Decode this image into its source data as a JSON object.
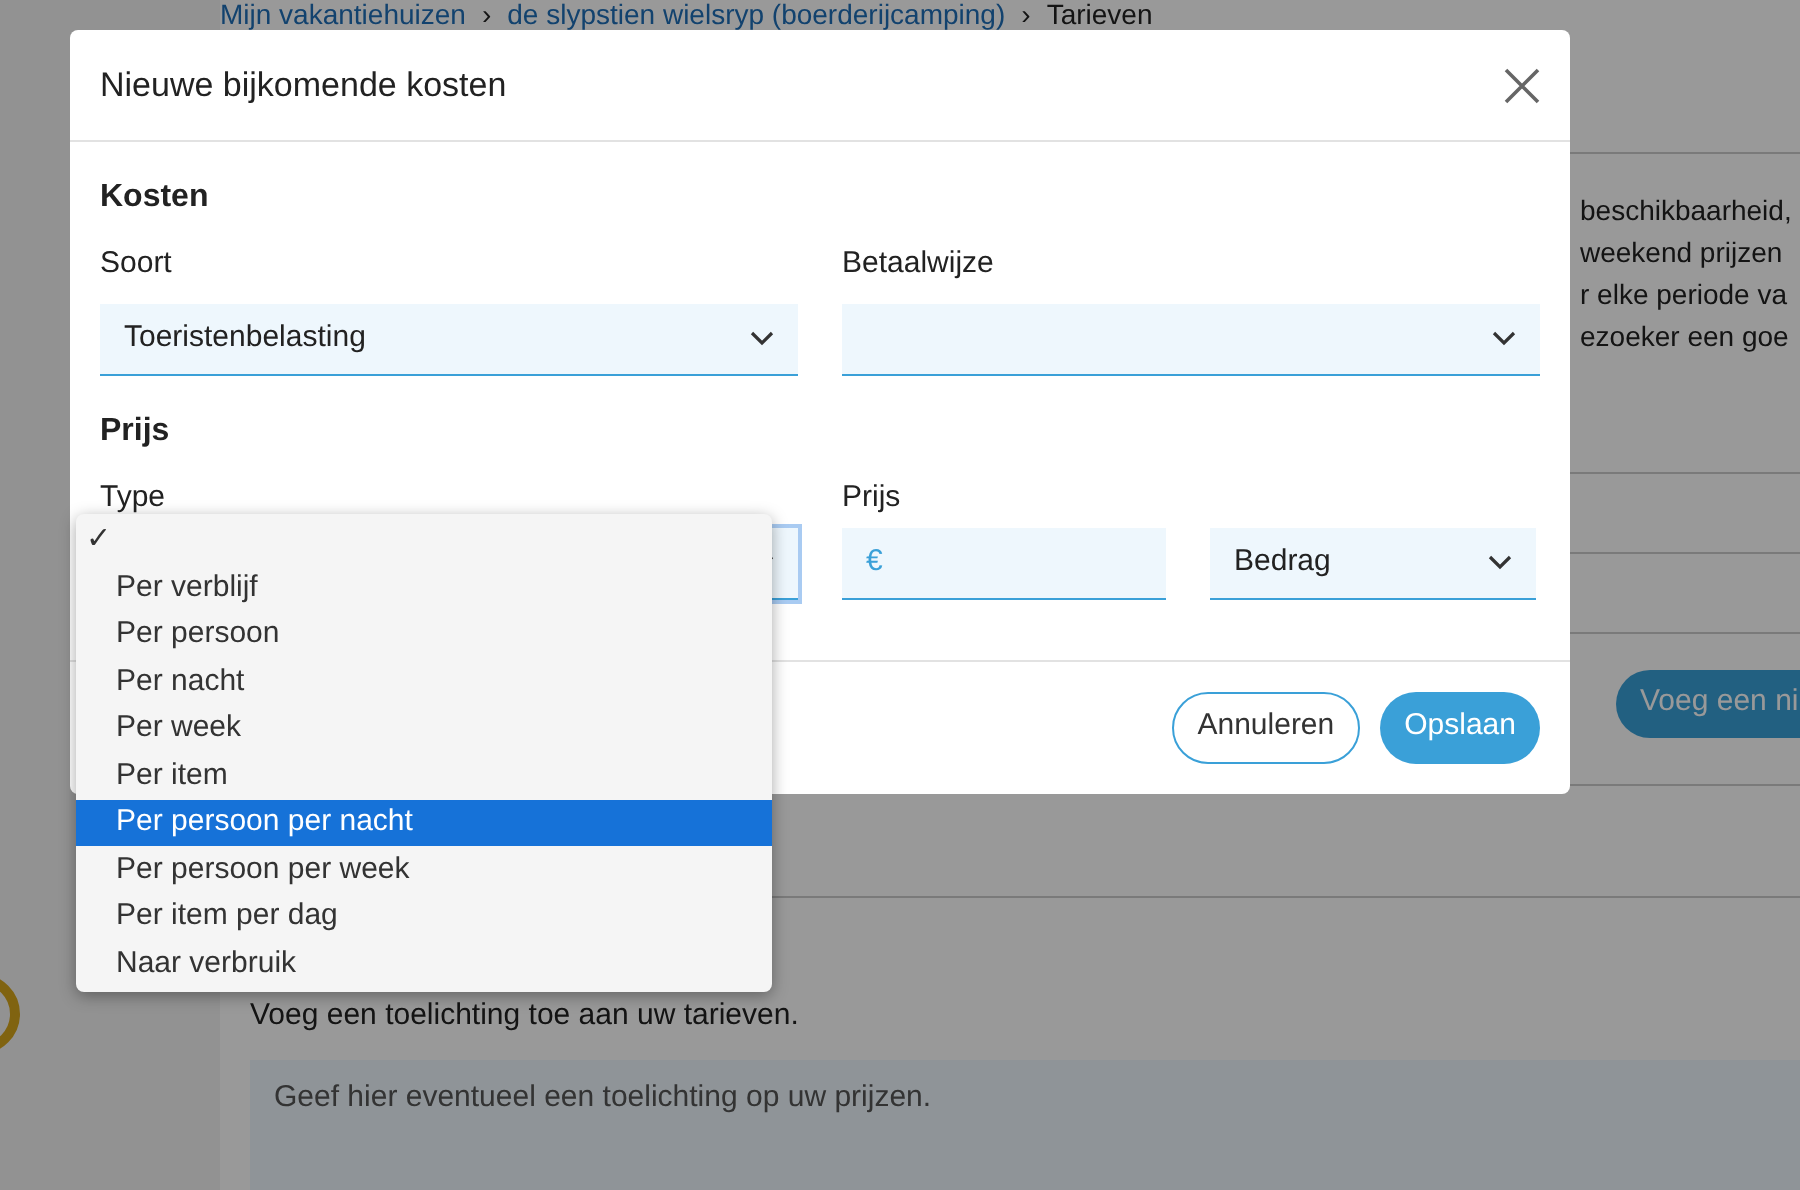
{
  "background": {
    "breadcrumb": [
      {
        "text": "Mijn vakantiehuizen",
        "kind": "link"
      },
      {
        "text": "›",
        "kind": "separator"
      },
      {
        "text": "de slypstien wielsryp (boerderijcamping)",
        "kind": "link"
      },
      {
        "text": "›",
        "kind": "separator"
      },
      {
        "text": "Tarieven",
        "kind": "current"
      }
    ],
    "intro_lines": [
      "beschikbaarheid,",
      "weekend prijzen",
      "r elke periode va",
      "ezoeker een goe"
    ],
    "add_button": "Voeg een ni",
    "note_label": "Voeg een toelichting toe aan uw tarieven.",
    "note_field": {
      "placeholder": "Geef hier eventueel een toelichting op uw prijzen."
    }
  },
  "dialog": {
    "title": "Nieuwe bijkomende kosten",
    "sections": [
      {
        "heading": "Kosten",
        "fields": [
          {
            "label": "Soort",
            "kind": "select",
            "value": "Toeristenbelasting"
          },
          {
            "label": "Betaalwijze",
            "kind": "select"
          }
        ]
      },
      {
        "heading": "Prijs",
        "fields": [
          {
            "label": "Type",
            "kind": "select",
            "focused": true
          },
          {
            "label": "Prijs",
            "kind": "money",
            "prefix": "€"
          },
          {
            "kind": "select",
            "value": "Bedrag"
          }
        ]
      }
    ],
    "buttons": [
      {
        "label": "Annuleren",
        "kind": "secondary"
      },
      {
        "label": "Opslaan",
        "kind": "primary"
      }
    ]
  },
  "type_dropdown": {
    "blank_option": {
      "mark": "✓",
      "checked": true
    },
    "options": [
      {
        "label": "Per verblijf",
        "highlighted": false
      },
      {
        "label": "Per persoon",
        "highlighted": false
      },
      {
        "label": "Per nacht",
        "highlighted": false
      },
      {
        "label": "Per week",
        "highlighted": false
      },
      {
        "label": "Per item",
        "highlighted": false
      },
      {
        "label": "Per persoon per nacht",
        "highlighted": true
      },
      {
        "label": "Per persoon per week",
        "highlighted": false
      },
      {
        "label": "Per item per dag",
        "highlighted": false
      },
      {
        "label": "Naar verbruik",
        "highlighted": false
      }
    ]
  }
}
